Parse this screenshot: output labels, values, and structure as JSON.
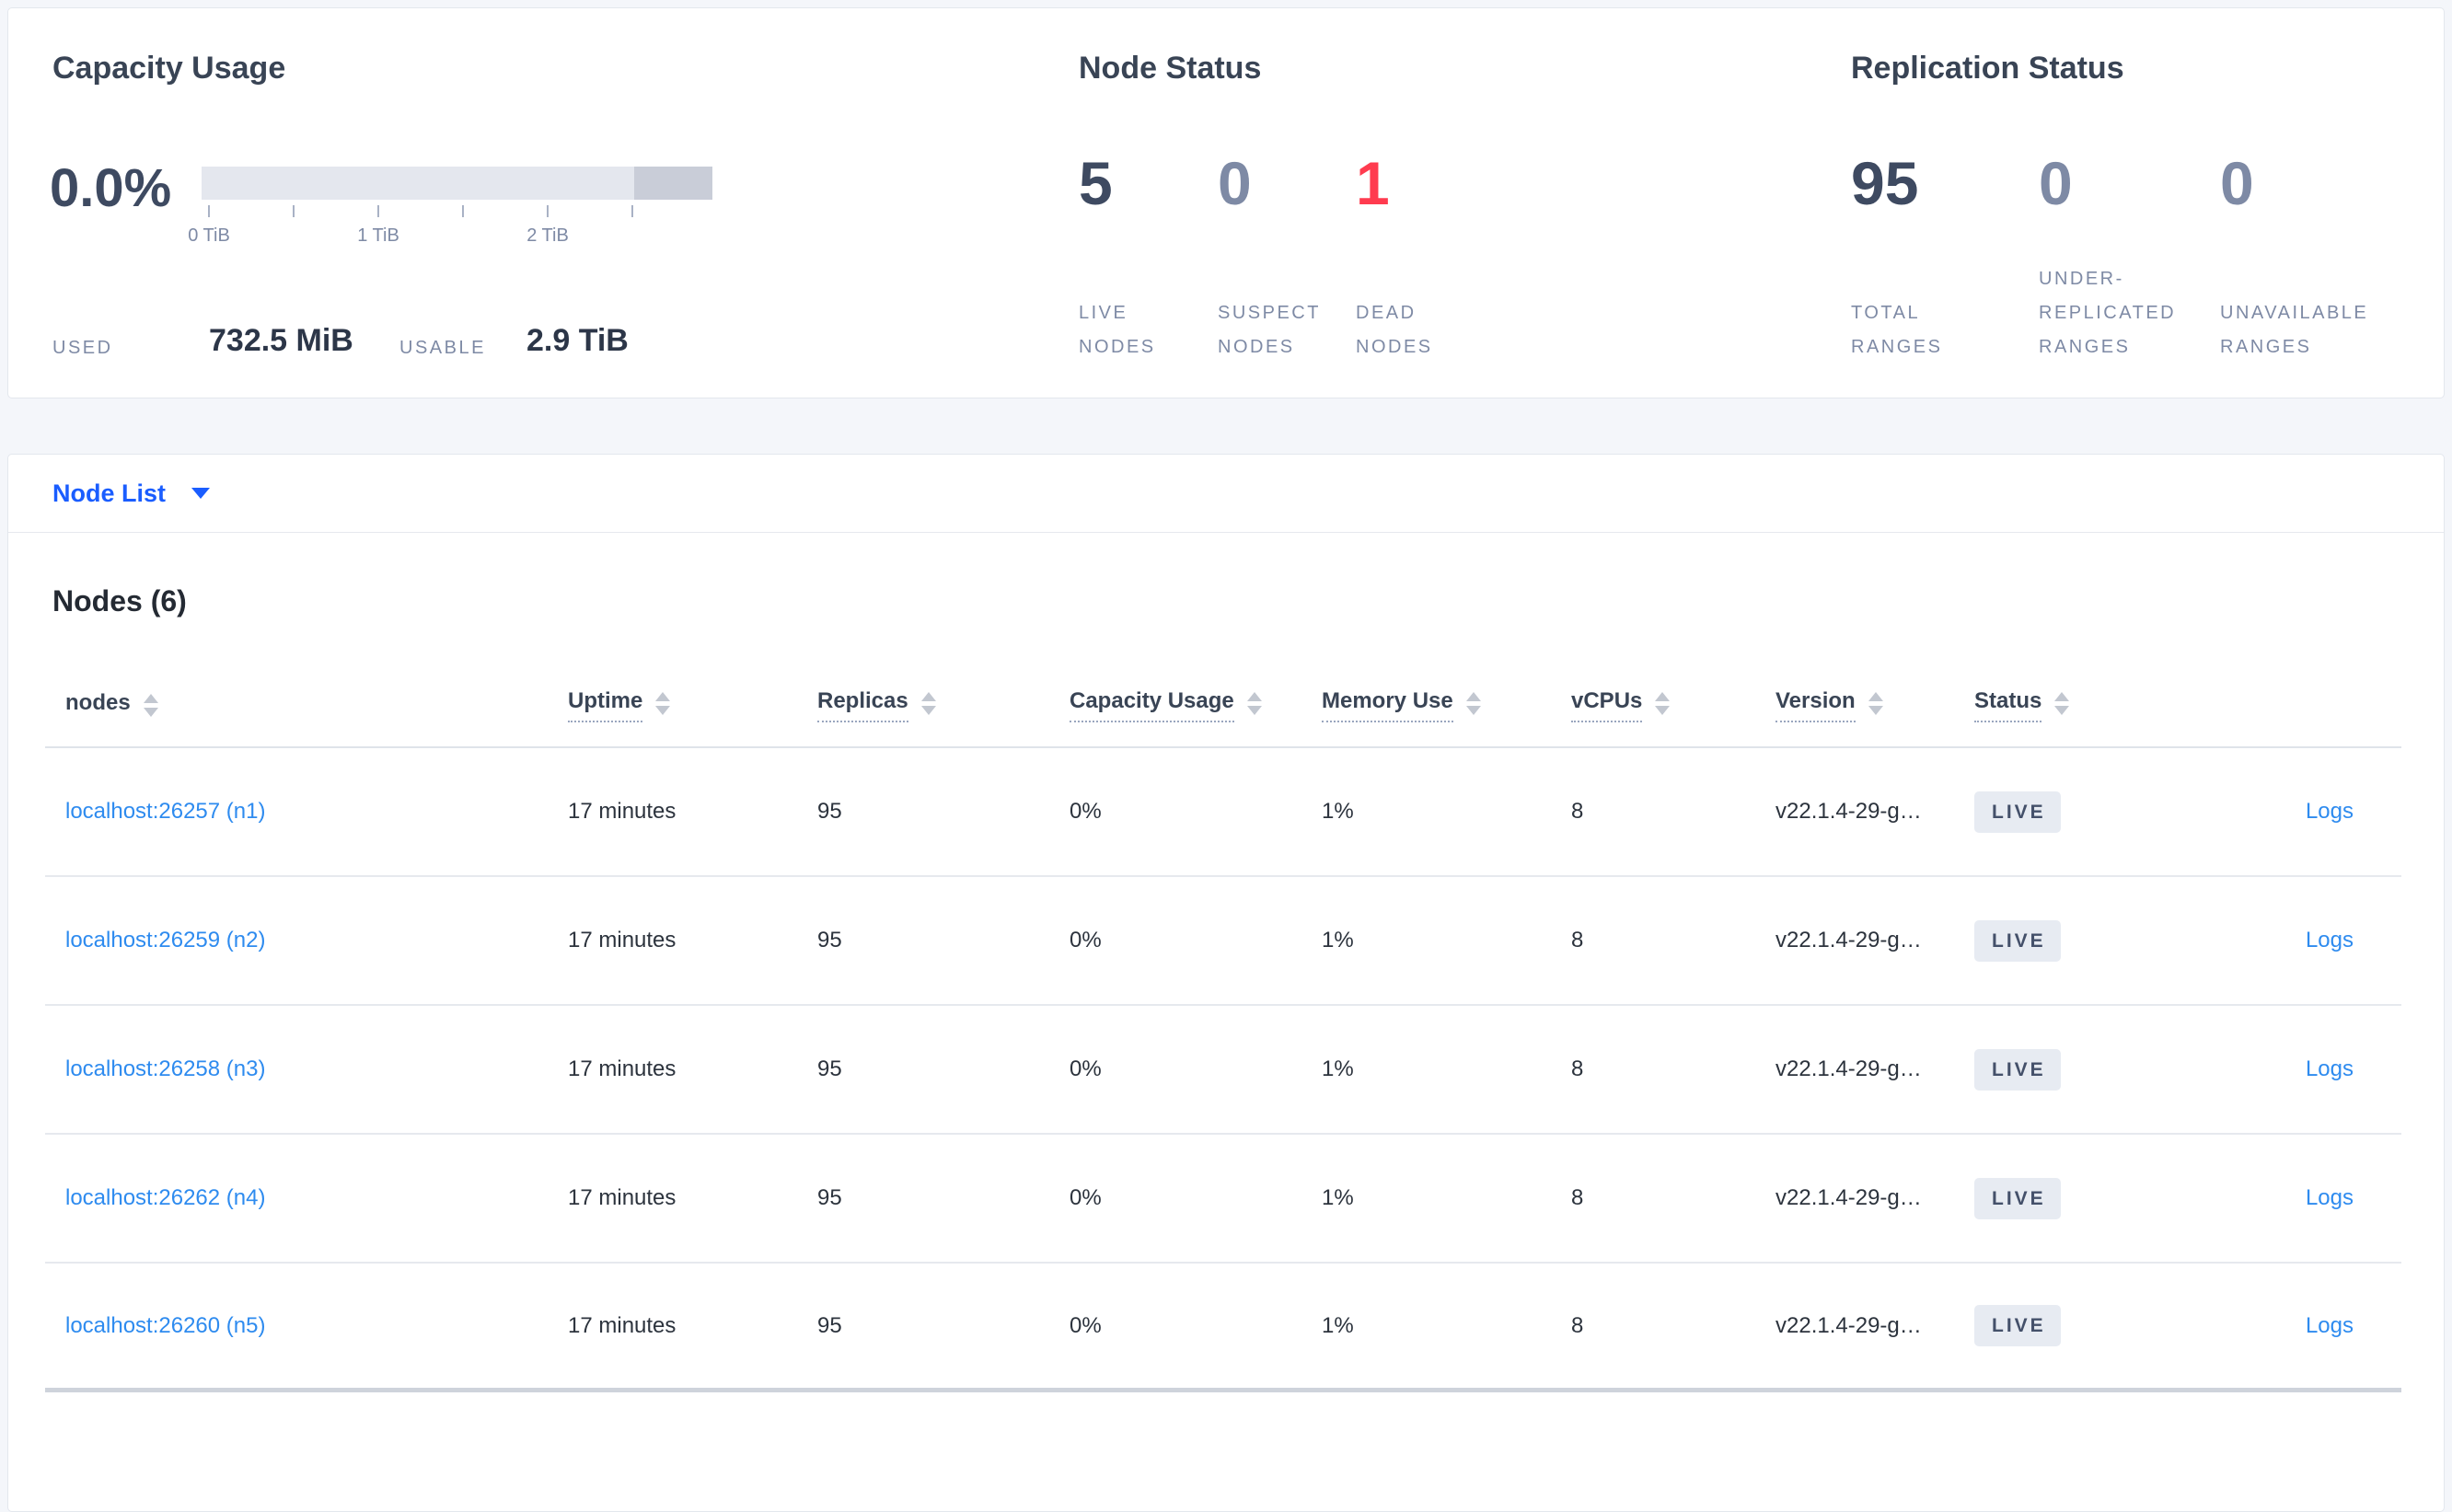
{
  "summary": {
    "capacity": {
      "title": "Capacity Usage",
      "percent": "0.0%",
      "tick_labels": [
        "0 TiB",
        "1 TiB",
        "2 TiB"
      ],
      "used_label": "USED",
      "used_value": "732.5 MiB",
      "usable_label": "USABLE",
      "usable_value": "2.9 TiB"
    },
    "node_status": {
      "title": "Node Status",
      "stats": [
        {
          "value": "5",
          "label": "LIVE\nNODES"
        },
        {
          "value": "0",
          "label": "SUSPECT\nNODES"
        },
        {
          "value": "1",
          "label": "DEAD\nNODES"
        }
      ]
    },
    "replication": {
      "title": "Replication Status",
      "stats": [
        {
          "value": "95",
          "label": "TOTAL\nRANGES"
        },
        {
          "value": "0",
          "label": "UNDER-\nREPLICATED\nRANGES"
        },
        {
          "value": "0",
          "label": "UNAVAILABLE\nRANGES"
        }
      ]
    }
  },
  "selector": {
    "label": "Node List"
  },
  "nodes_table": {
    "title": "Nodes (6)",
    "columns": {
      "nodes": "nodes",
      "uptime": "Uptime",
      "replicas": "Replicas",
      "capacity": "Capacity Usage",
      "memory": "Memory Use",
      "vcpus": "vCPUs",
      "version": "Version",
      "status": "Status"
    },
    "rows": [
      {
        "node": "localhost:26257 (n1)",
        "uptime": "17 minutes",
        "replicas": "95",
        "capacity": "0%",
        "memory": "1%",
        "vcpus": "8",
        "version": "v22.1.4-29-g…",
        "status": "LIVE",
        "logs": "Logs"
      },
      {
        "node": "localhost:26259 (n2)",
        "uptime": "17 minutes",
        "replicas": "95",
        "capacity": "0%",
        "memory": "1%",
        "vcpus": "8",
        "version": "v22.1.4-29-g…",
        "status": "LIVE",
        "logs": "Logs"
      },
      {
        "node": "localhost:26258 (n3)",
        "uptime": "17 minutes",
        "replicas": "95",
        "capacity": "0%",
        "memory": "1%",
        "vcpus": "8",
        "version": "v22.1.4-29-g…",
        "status": "LIVE",
        "logs": "Logs"
      },
      {
        "node": "localhost:26262 (n4)",
        "uptime": "17 minutes",
        "replicas": "95",
        "capacity": "0%",
        "memory": "1%",
        "vcpus": "8",
        "version": "v22.1.4-29-g…",
        "status": "LIVE",
        "logs": "Logs"
      },
      {
        "node": "localhost:26260 (n5)",
        "uptime": "17 minutes",
        "replicas": "95",
        "capacity": "0%",
        "memory": "1%",
        "vcpus": "8",
        "version": "v22.1.4-29-g…",
        "status": "LIVE",
        "logs": "Logs"
      }
    ]
  },
  "colors": {
    "selector_blue": "#1a5dff",
    "link_blue": "#2e8bef",
    "danger_red": "#ff3b4f",
    "dark_slate": "#3e4a61",
    "muted_slate": "#7e8aa5",
    "badge_bg": "#e7ebf2"
  }
}
